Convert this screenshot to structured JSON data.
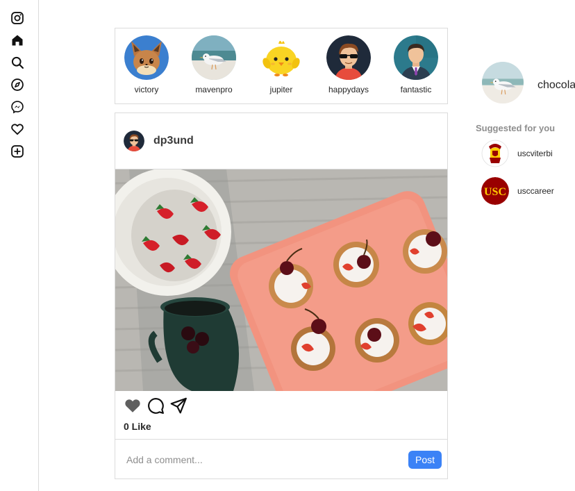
{
  "sidebar": {
    "items": [
      {
        "icon": "instagram-icon"
      },
      {
        "icon": "home-icon"
      },
      {
        "icon": "search-icon"
      },
      {
        "icon": "explore-compass-icon"
      },
      {
        "icon": "messenger-icon"
      },
      {
        "icon": "heart-icon"
      },
      {
        "icon": "add-post-icon"
      }
    ]
  },
  "stories": [
    {
      "name": "victory"
    },
    {
      "name": "mavenpro"
    },
    {
      "name": "jupiter"
    },
    {
      "name": "happydays"
    },
    {
      "name": "fantastic"
    }
  ],
  "post": {
    "username": "dp3und",
    "likes": "0 Like",
    "comment_placeholder": "Add a comment...",
    "post_button": "Post"
  },
  "right": {
    "profile_name": "chocolate",
    "suggested_title": "Suggested for you",
    "suggestions": [
      {
        "name": "uscviterbi"
      },
      {
        "name": "usccareer"
      }
    ]
  },
  "colors": {
    "accent": "#3b82f6",
    "border": "#dbdbdb",
    "muted": "#8e8e8e",
    "usc_cardinal": "#990000",
    "usc_gold": "#ffcc00"
  }
}
